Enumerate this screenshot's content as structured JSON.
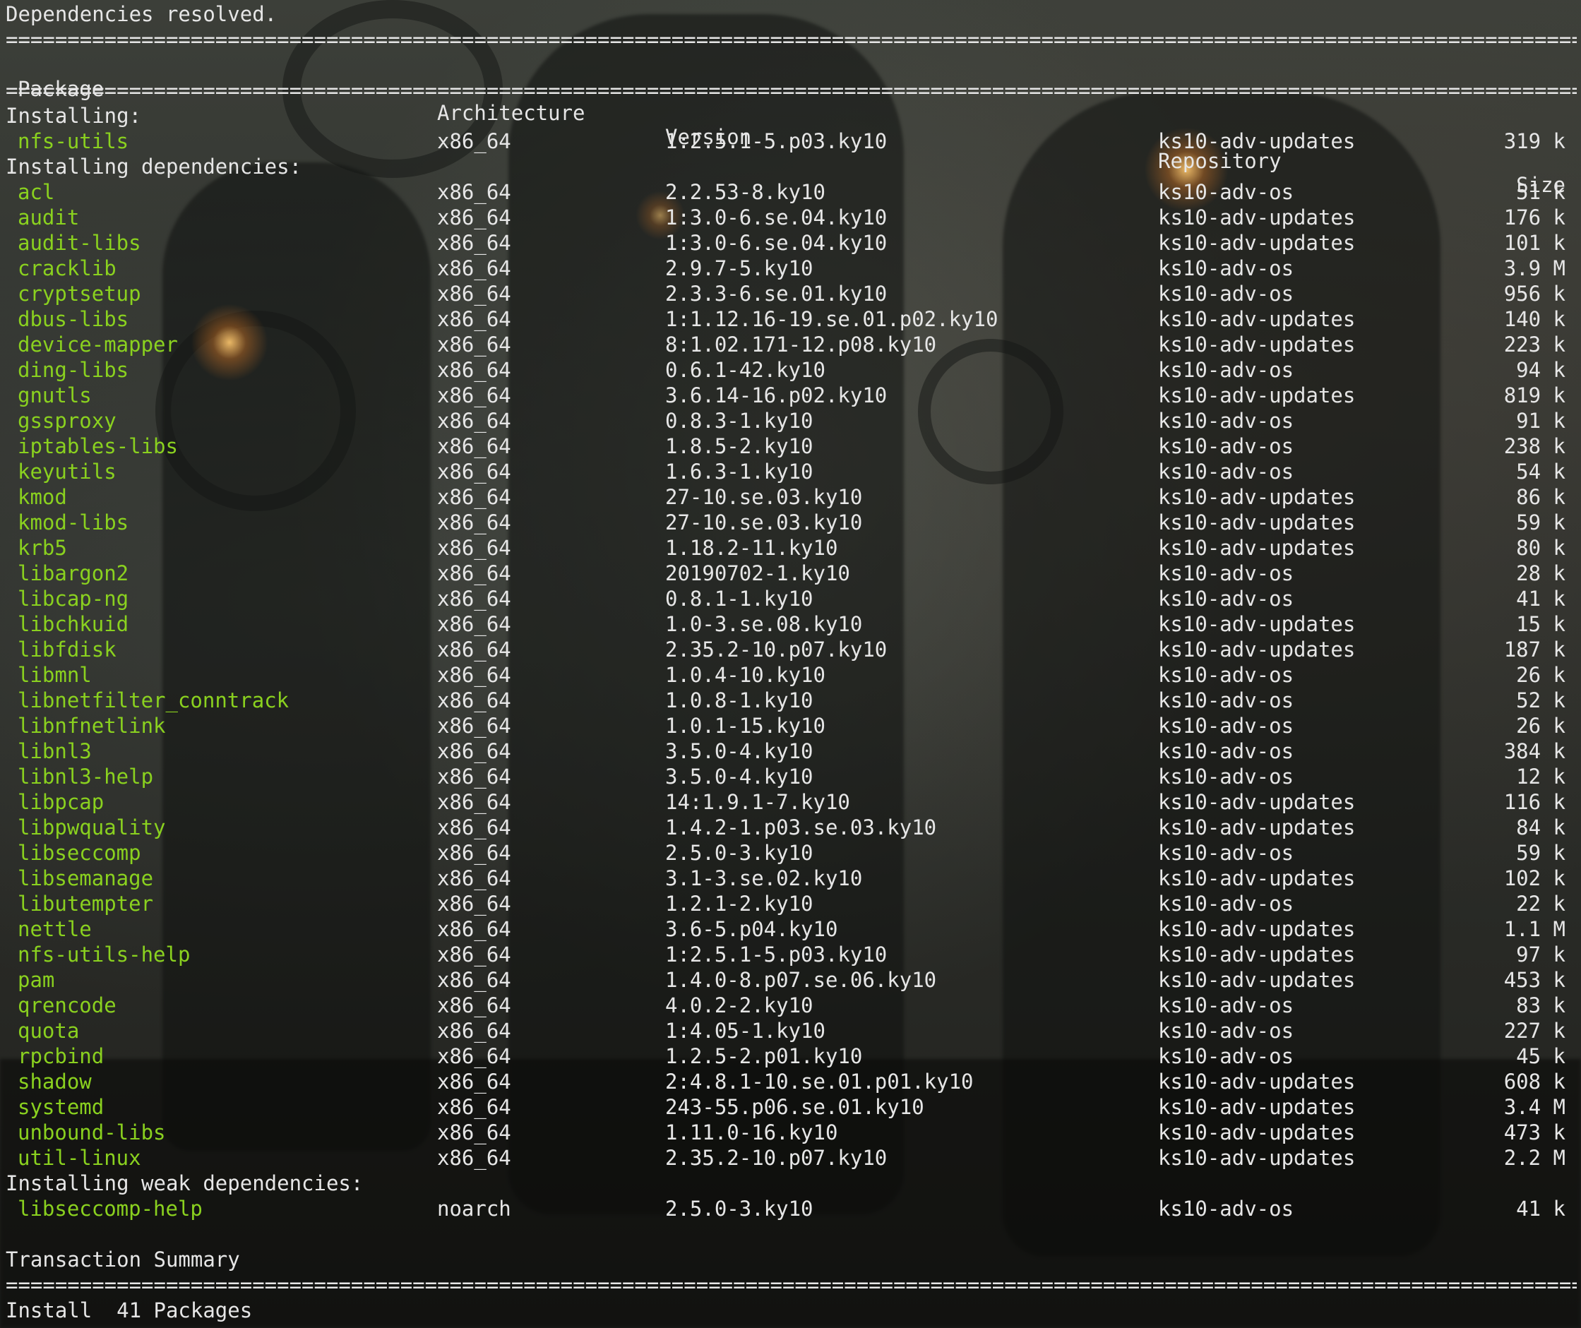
{
  "status_line": "Dependencies resolved.",
  "rule": "==================================================================================================================================================",
  "columns": {
    "package": "Package",
    "architecture": "Architecture",
    "version": "Version",
    "repository": "Repository",
    "size": "Size"
  },
  "sections": {
    "installing": "Installing:",
    "installing_deps": "Installing dependencies:",
    "installing_weak": "Installing weak dependencies:"
  },
  "installing": [
    {
      "name": "nfs-utils",
      "arch": "x86_64",
      "version": "1:2.5.1-5.p03.ky10",
      "repo": "ks10-adv-updates",
      "size": "319 k"
    }
  ],
  "dependencies": [
    {
      "name": "acl",
      "arch": "x86_64",
      "version": "2.2.53-8.ky10",
      "repo": "ks10-adv-os",
      "size": "51 k"
    },
    {
      "name": "audit",
      "arch": "x86_64",
      "version": "1:3.0-6.se.04.ky10",
      "repo": "ks10-adv-updates",
      "size": "176 k"
    },
    {
      "name": "audit-libs",
      "arch": "x86_64",
      "version": "1:3.0-6.se.04.ky10",
      "repo": "ks10-adv-updates",
      "size": "101 k"
    },
    {
      "name": "cracklib",
      "arch": "x86_64",
      "version": "2.9.7-5.ky10",
      "repo": "ks10-adv-os",
      "size": "3.9 M"
    },
    {
      "name": "cryptsetup",
      "arch": "x86_64",
      "version": "2.3.3-6.se.01.ky10",
      "repo": "ks10-adv-os",
      "size": "956 k"
    },
    {
      "name": "dbus-libs",
      "arch": "x86_64",
      "version": "1:1.12.16-19.se.01.p02.ky10",
      "repo": "ks10-adv-updates",
      "size": "140 k"
    },
    {
      "name": "device-mapper",
      "arch": "x86_64",
      "version": "8:1.02.171-12.p08.ky10",
      "repo": "ks10-adv-updates",
      "size": "223 k"
    },
    {
      "name": "ding-libs",
      "arch": "x86_64",
      "version": "0.6.1-42.ky10",
      "repo": "ks10-adv-os",
      "size": "94 k"
    },
    {
      "name": "gnutls",
      "arch": "x86_64",
      "version": "3.6.14-16.p02.ky10",
      "repo": "ks10-adv-updates",
      "size": "819 k"
    },
    {
      "name": "gssproxy",
      "arch": "x86_64",
      "version": "0.8.3-1.ky10",
      "repo": "ks10-adv-os",
      "size": "91 k"
    },
    {
      "name": "iptables-libs",
      "arch": "x86_64",
      "version": "1.8.5-2.ky10",
      "repo": "ks10-adv-os",
      "size": "238 k"
    },
    {
      "name": "keyutils",
      "arch": "x86_64",
      "version": "1.6.3-1.ky10",
      "repo": "ks10-adv-os",
      "size": "54 k"
    },
    {
      "name": "kmod",
      "arch": "x86_64",
      "version": "27-10.se.03.ky10",
      "repo": "ks10-adv-updates",
      "size": "86 k"
    },
    {
      "name": "kmod-libs",
      "arch": "x86_64",
      "version": "27-10.se.03.ky10",
      "repo": "ks10-adv-updates",
      "size": "59 k"
    },
    {
      "name": "krb5",
      "arch": "x86_64",
      "version": "1.18.2-11.ky10",
      "repo": "ks10-adv-updates",
      "size": "80 k"
    },
    {
      "name": "libargon2",
      "arch": "x86_64",
      "version": "20190702-1.ky10",
      "repo": "ks10-adv-os",
      "size": "28 k"
    },
    {
      "name": "libcap-ng",
      "arch": "x86_64",
      "version": "0.8.1-1.ky10",
      "repo": "ks10-adv-os",
      "size": "41 k"
    },
    {
      "name": "libchkuid",
      "arch": "x86_64",
      "version": "1.0-3.se.08.ky10",
      "repo": "ks10-adv-updates",
      "size": "15 k"
    },
    {
      "name": "libfdisk",
      "arch": "x86_64",
      "version": "2.35.2-10.p07.ky10",
      "repo": "ks10-adv-updates",
      "size": "187 k"
    },
    {
      "name": "libmnl",
      "arch": "x86_64",
      "version": "1.0.4-10.ky10",
      "repo": "ks10-adv-os",
      "size": "26 k"
    },
    {
      "name": "libnetfilter_conntrack",
      "arch": "x86_64",
      "version": "1.0.8-1.ky10",
      "repo": "ks10-adv-os",
      "size": "52 k"
    },
    {
      "name": "libnfnetlink",
      "arch": "x86_64",
      "version": "1.0.1-15.ky10",
      "repo": "ks10-adv-os",
      "size": "26 k"
    },
    {
      "name": "libnl3",
      "arch": "x86_64",
      "version": "3.5.0-4.ky10",
      "repo": "ks10-adv-os",
      "size": "384 k"
    },
    {
      "name": "libnl3-help",
      "arch": "x86_64",
      "version": "3.5.0-4.ky10",
      "repo": "ks10-adv-os",
      "size": "12 k"
    },
    {
      "name": "libpcap",
      "arch": "x86_64",
      "version": "14:1.9.1-7.ky10",
      "repo": "ks10-adv-updates",
      "size": "116 k"
    },
    {
      "name": "libpwquality",
      "arch": "x86_64",
      "version": "1.4.2-1.p03.se.03.ky10",
      "repo": "ks10-adv-updates",
      "size": "84 k"
    },
    {
      "name": "libseccomp",
      "arch": "x86_64",
      "version": "2.5.0-3.ky10",
      "repo": "ks10-adv-os",
      "size": "59 k"
    },
    {
      "name": "libsemanage",
      "arch": "x86_64",
      "version": "3.1-3.se.02.ky10",
      "repo": "ks10-adv-updates",
      "size": "102 k"
    },
    {
      "name": "libutempter",
      "arch": "x86_64",
      "version": "1.2.1-2.ky10",
      "repo": "ks10-adv-os",
      "size": "22 k"
    },
    {
      "name": "nettle",
      "arch": "x86_64",
      "version": "3.6-5.p04.ky10",
      "repo": "ks10-adv-updates",
      "size": "1.1 M"
    },
    {
      "name": "nfs-utils-help",
      "arch": "x86_64",
      "version": "1:2.5.1-5.p03.ky10",
      "repo": "ks10-adv-updates",
      "size": "97 k"
    },
    {
      "name": "pam",
      "arch": "x86_64",
      "version": "1.4.0-8.p07.se.06.ky10",
      "repo": "ks10-adv-updates",
      "size": "453 k"
    },
    {
      "name": "qrencode",
      "arch": "x86_64",
      "version": "4.0.2-2.ky10",
      "repo": "ks10-adv-os",
      "size": "83 k"
    },
    {
      "name": "quota",
      "arch": "x86_64",
      "version": "1:4.05-1.ky10",
      "repo": "ks10-adv-os",
      "size": "227 k"
    },
    {
      "name": "rpcbind",
      "arch": "x86_64",
      "version": "1.2.5-2.p01.ky10",
      "repo": "ks10-adv-os",
      "size": "45 k"
    },
    {
      "name": "shadow",
      "arch": "x86_64",
      "version": "2:4.8.1-10.se.01.p01.ky10",
      "repo": "ks10-adv-updates",
      "size": "608 k"
    },
    {
      "name": "systemd",
      "arch": "x86_64",
      "version": "243-55.p06.se.01.ky10",
      "repo": "ks10-adv-updates",
      "size": "3.4 M"
    },
    {
      "name": "unbound-libs",
      "arch": "x86_64",
      "version": "1.11.0-16.ky10",
      "repo": "ks10-adv-updates",
      "size": "473 k"
    },
    {
      "name": "util-linux",
      "arch": "x86_64",
      "version": "2.35.2-10.p07.ky10",
      "repo": "ks10-adv-updates",
      "size": "2.2 M"
    }
  ],
  "weak_dependencies": [
    {
      "name": "libseccomp-help",
      "arch": "noarch",
      "version": "2.5.0-3.ky10",
      "repo": "ks10-adv-os",
      "size": "41 k"
    }
  ],
  "summary_title": "Transaction Summary",
  "install_line": "Install  41 Packages",
  "colors": {
    "text": "#e6e6e6",
    "package_name": "#8ad11f",
    "background": "#2a2c28"
  }
}
